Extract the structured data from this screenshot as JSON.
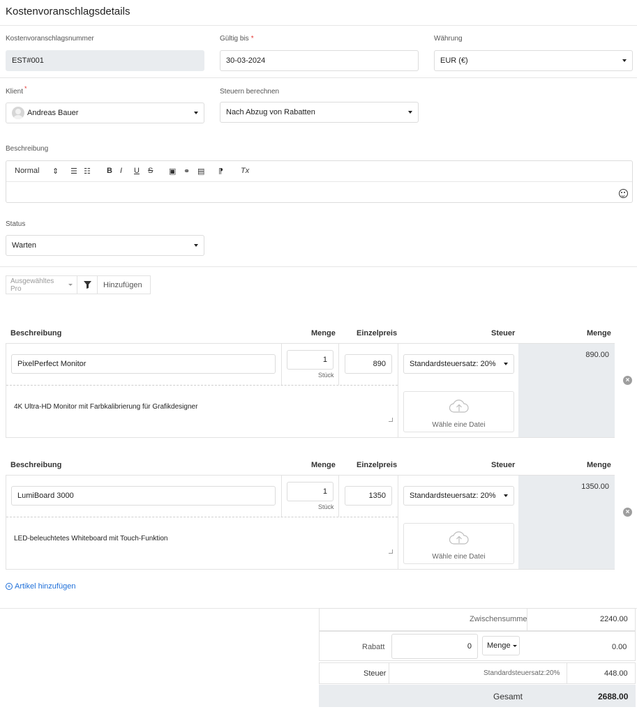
{
  "page_title": "Kostenvoranschlagsdetails",
  "form": {
    "number_label": "Kostenvoranschlagsnummer",
    "number_value": "EST#001",
    "valid_label": "Gültig bis",
    "valid_value": "30-03-2024",
    "currency_label": "Währung",
    "currency_value": "EUR (€)",
    "client_label": "Klient",
    "client_value": "Andreas Bauer",
    "tax_calc_label": "Steuern berechnen",
    "tax_calc_value": "Nach Abzug von Rabatten",
    "description_label": "Beschreibung",
    "status_label": "Status",
    "status_value": "Warten",
    "required_mark": "*"
  },
  "editor": {
    "heading_select": "Normal",
    "updown": "⇕",
    "ordered_list": "☰",
    "bullet_list": "☷",
    "bold": "B",
    "italic": "I",
    "underline": "U",
    "strike": "S",
    "image": "▣",
    "link": "⚭",
    "video": "▤",
    "rtl": "⁋",
    "clean": "Tx"
  },
  "products": {
    "selected_placeholder": "Ausgewähltes Pro",
    "add_label": "Hinzufügen"
  },
  "table_headers": {
    "description": "Beschreibung",
    "quantity": "Menge",
    "unit_price": "Einzelpreis",
    "tax": "Steuer",
    "amount": "Menge"
  },
  "items": [
    {
      "name": "PixelPerfect Monitor",
      "quantity": "1",
      "unit": "Stück",
      "price": "890",
      "tax": "Standardsteuersatz: 20%",
      "amount": "890.00",
      "description": "4K Ultra-HD Monitor mit Farbkalibrierung für Grafikdesigner",
      "upload_label": "Wähle eine Datei"
    },
    {
      "name": "LumiBoard 3000",
      "quantity": "1",
      "unit": "Stück",
      "price": "1350",
      "tax": "Standardsteuersatz: 20%",
      "amount": "1350.00",
      "description": "LED-beleuchtetes Whiteboard mit Touch-Funktion",
      "upload_label": "Wähle eine Datei"
    }
  ],
  "add_item_label": "Artikel hinzufügen",
  "totals": {
    "subtotal_label": "Zwischensumme",
    "subtotal_value": "2240.00",
    "discount_label": "Rabatt",
    "discount_input": "0",
    "discount_type": "Menge",
    "discount_value": "0.00",
    "tax_label": "Steuer",
    "tax_name": "Standardsteuersatz:20%",
    "tax_value": "448.00",
    "total_label": "Gesamt",
    "total_value": "2688.00"
  },
  "icons": {
    "remove": "×",
    "plus": "+"
  }
}
